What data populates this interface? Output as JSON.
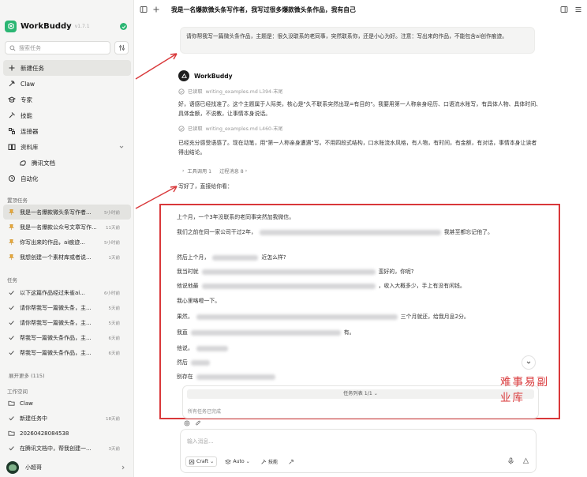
{
  "app": {
    "name": "WorkBuddy",
    "version": "v1.7.1"
  },
  "sidebar": {
    "search_placeholder": "搜索任务",
    "nav": [
      {
        "label": "新建任务",
        "icon": "plus-icon"
      },
      {
        "label": "Claw",
        "icon": "claw-icon"
      },
      {
        "label": "专家",
        "icon": "expert-icon"
      },
      {
        "label": "技能",
        "icon": "skill-icon"
      },
      {
        "label": "连接器",
        "icon": "connector-icon"
      },
      {
        "label": "资料库",
        "icon": "library-icon"
      },
      {
        "label": "腾讯文档",
        "icon": "tencent-docs-icon"
      },
      {
        "label": "自动化",
        "icon": "automation-icon"
      }
    ],
    "pinned_label": "置顶任务",
    "pinned": [
      {
        "text": "我是一名爆款微头条写作者...",
        "time": "5小时前"
      },
      {
        "text": "我是一名爆款公众号文章写作...",
        "time": "11天前"
      },
      {
        "text": "你写出来的作品，ai痕迹...",
        "time": "5小时前"
      },
      {
        "text": "我想创建一个素材库或者说...",
        "time": "1天前"
      }
    ],
    "tasks_label": "任务",
    "tasks": [
      {
        "text": "以下这篇作品经过朱雀ai...",
        "time": "6小时前"
      },
      {
        "text": "请你帮我写一篇微头条，主...",
        "time": "5天前"
      },
      {
        "text": "请你帮我写一篇微头条，主...",
        "time": "5天前"
      },
      {
        "text": "帮我写一篇微头条作品，主...",
        "time": "6天前"
      },
      {
        "text": "帮我写一篇微头条作品，主...",
        "time": "6天前"
      }
    ],
    "expand_more": "展开更多 (115)",
    "workspace_label": "工作空间",
    "workspace": [
      {
        "text": "Claw",
        "time": "",
        "icon": "folder-icon"
      },
      {
        "text": "新建任务中",
        "time": "18天前",
        "icon": "check-icon"
      },
      {
        "text": "20260428084538",
        "time": "",
        "icon": "folder-icon"
      },
      {
        "text": "在腾讯文档中，帮我创建一...",
        "time": "3天前",
        "icon": "check-icon"
      }
    ],
    "user_name": "小超哥"
  },
  "main": {
    "title": "我是一名爆款微头条写作者，我写过很多爆款微头条作品，我有自己",
    "user_message": "请你帮我写一篇微头条作品，主题是：很久没联系的老同事，突然联系你，还是小心为好。注意：写出来的作品，不能包含ai创作痕迹。",
    "assistant_name": "WorkBuddy",
    "read1_label": "已读取",
    "read1_file": "writing_examples.md  L394-末尾",
    "para1": "好，语感已经找准了。这个主题属于人际类，核心是\"久不联系突然出现=有目的\"。我要用第一人称亲身经历、口语流水账写，有具体人物、具体时间、具体金额，不说教，让事情本身说话。",
    "read2_label": "已读取",
    "read2_file": "writing_examples.md  L460-末尾",
    "para2": "已经充分感受语感了。现在动笔，用\"第一人称亲身遭遇\"写。不用四段式结构，口水账流水风格，有人物，有时间，有金额，有对话，事情本身让读者得出结论。",
    "tool_call": "工具调用 1",
    "process_msg": "过程消息 8",
    "intro": "写好了，直接给你看：",
    "output_lines": [
      "上个月，一个3年没联系的老同事突然加我微信。",
      "我们之前在同一家公司干过2年，",
      "我甚至都忘记他了。",
      "然后上个月，",
      "近怎么样?",
      "我当时就",
      "蛮好的，你呢?",
      "他说他最",
      "，收入大概多少，手上有没有闲钱。",
      "我心里咯噔一下。",
      "果然，",
      "三个月就还，给我月息2分。",
      "我直",
      "有。",
      "他说，",
      "然后",
      "别存在"
    ],
    "task_list_title": "任务列表 1/1",
    "task_done": "所有任务已完成",
    "watermark": "难事易副业库",
    "input_placeholder": "输入消息...",
    "mode_label": "Craft",
    "auto_label": "Auto",
    "skills_label": "技能"
  },
  "colors": {
    "brand_green": "#2bb673",
    "annotation_red": "#d9383a"
  }
}
